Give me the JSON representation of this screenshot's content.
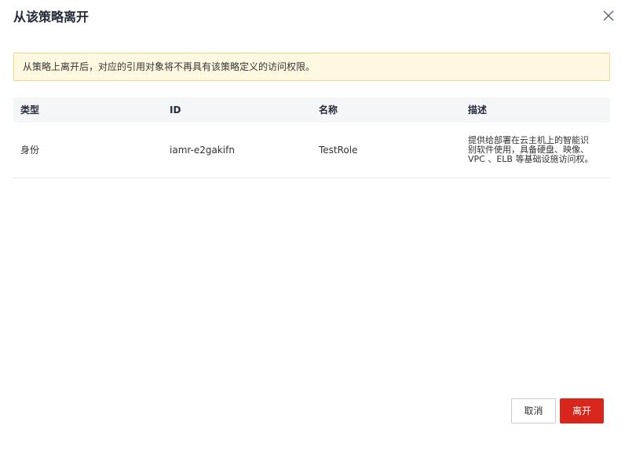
{
  "dialog": {
    "title": "从该策略离开",
    "close_icon": "close-icon"
  },
  "alert": {
    "message": "从策略上离开后，对应的引用对象将不再具有该策略定义的访问权限。",
    "background": "#fff8e1",
    "border": "#f5d38a"
  },
  "table": {
    "headers": [
      "类型",
      "ID",
      "名称",
      "描述"
    ],
    "rows": [
      {
        "type": "身份",
        "id": "iamr-e2gakifn",
        "name": "TestRole",
        "description": "提供给部署在云主机上的智能识别软件使用，具备硬盘、映像、VPC 、ELB 等基础设施访问权。"
      }
    ]
  },
  "footer": {
    "cancel_label": "取消",
    "leave_label": "离开",
    "leave_color": "#d9261c"
  }
}
